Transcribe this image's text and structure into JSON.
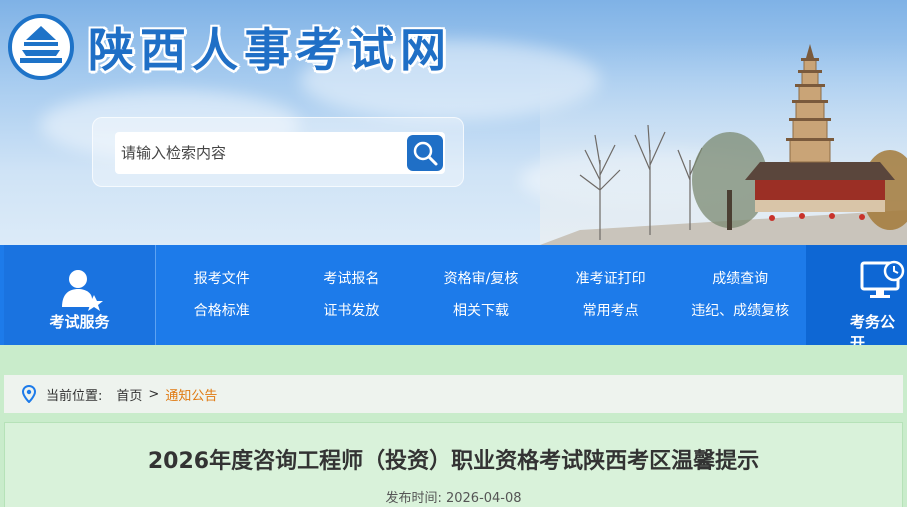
{
  "site": {
    "title": "陕西人事考试网"
  },
  "search": {
    "placeholder": "请输入检索内容"
  },
  "nav": {
    "left_label": "考试服务",
    "right_label": "考务公开",
    "links": [
      "报考文件",
      "考试报名",
      "资格审/复核",
      "准考证打印",
      "成绩查询",
      "合格标准",
      "证书发放",
      "相关下载",
      "常用考点",
      "违纪、成绩复核"
    ]
  },
  "breadcrumb": {
    "prefix": "当前位置:",
    "home": "首页",
    "separator": ">",
    "current": "通知公告"
  },
  "article": {
    "title": "2026年度咨询工程师（投资）职业资格考试陕西考区温馨提示",
    "date_label": "发布时间:",
    "date": "2026-04-08"
  },
  "colors": {
    "brand_blue": "#1d7bea",
    "accent_orange": "#e07a12",
    "page_green": "#c9eccb"
  }
}
